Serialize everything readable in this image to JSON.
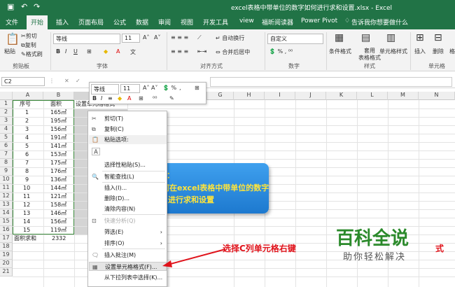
{
  "window": {
    "title": "excel表格中带单位的数字如何进行求和设置.xlsx - Excel"
  },
  "tabs": [
    {
      "label": "文件"
    },
    {
      "label": "开始"
    },
    {
      "label": "插入"
    },
    {
      "label": "页面布局"
    },
    {
      "label": "公式"
    },
    {
      "label": "数据"
    },
    {
      "label": "审阅"
    },
    {
      "label": "视图"
    },
    {
      "label": "开发工具"
    },
    {
      "label": "view"
    },
    {
      "label": "福昕阅读器"
    },
    {
      "label": "Power Pivot"
    },
    {
      "label": "告诉我你想要做什么"
    }
  ],
  "ribbon": {
    "clipboard": {
      "paste": "粘贴",
      "cut": "剪切",
      "copy": "复制",
      "format_painter": "格式刷",
      "label": "剪贴板"
    },
    "font": {
      "name": "等线",
      "size": "11",
      "label": "字体"
    },
    "alignment": {
      "wrap": "自动换行",
      "merge": "合并后居中",
      "label": "对齐方式"
    },
    "number": {
      "format": "自定义",
      "label": "数字"
    },
    "styles": {
      "conditional": "条件格式",
      "table": "套用\n表格格式",
      "cell": "单元格样式",
      "label": "样式"
    },
    "cells": {
      "insert": "插入",
      "delete": "删除",
      "format": "格式",
      "label": "单元格"
    }
  },
  "formula_bar": {
    "name_box": "C2"
  },
  "columns": [
    "A",
    "B",
    "C",
    "D",
    "E",
    "F",
    "G",
    "H",
    "I",
    "J",
    "K",
    "L",
    "M",
    "N"
  ],
  "rows": [
    "1",
    "2",
    "3",
    "4",
    "5",
    "6",
    "7",
    "8",
    "9",
    "10",
    "11",
    "12",
    "13",
    "14",
    "15",
    "16",
    "17",
    "18",
    "19",
    "20",
    "21"
  ],
  "table": {
    "headers": [
      "序号",
      "面积",
      "设置单元格格式"
    ],
    "data": [
      [
        "1",
        "165㎡"
      ],
      [
        "2",
        "195㎡"
      ],
      [
        "3",
        "156㎡"
      ],
      [
        "4",
        "191㎡"
      ],
      [
        "5",
        "141㎡"
      ],
      [
        "6",
        "153㎡"
      ],
      [
        "7",
        "175㎡"
      ],
      [
        "8",
        "176㎡"
      ],
      [
        "9",
        "136㎡"
      ],
      [
        "10",
        "144㎡"
      ],
      [
        "11",
        "121㎡"
      ],
      [
        "12",
        "158㎡"
      ],
      [
        "13",
        "146㎡"
      ],
      [
        "14",
        "156㎡"
      ],
      [
        "15",
        "119㎡"
      ]
    ],
    "sum_label": "面积求和",
    "sum_value": "2332"
  },
  "mini_toolbar": {
    "font": "等线",
    "size": "11"
  },
  "context_menu": [
    {
      "label": "剪切(T)",
      "icon": "scissors-icon",
      "state": "normal"
    },
    {
      "label": "复制(C)",
      "icon": "copy-icon",
      "state": "normal"
    },
    {
      "label": "粘贴选项:",
      "icon": "paste-icon",
      "state": "header"
    },
    {
      "label": "",
      "icon": "paste-a-icon",
      "state": "normal"
    },
    {
      "label": "选择性粘贴(S)...",
      "icon": "",
      "state": "normal"
    },
    {
      "label": "智能查找(L)",
      "icon": "search-icon",
      "state": "normal"
    },
    {
      "label": "插入(I)...",
      "icon": "",
      "state": "normal"
    },
    {
      "label": "删除(D)...",
      "icon": "",
      "state": "normal"
    },
    {
      "label": "清除内容(N)",
      "icon": "",
      "state": "normal"
    },
    {
      "label": "快速分析(Q)",
      "icon": "quick-analysis-icon",
      "state": "disabled"
    },
    {
      "label": "筛选(E)",
      "icon": "",
      "state": "submenu"
    },
    {
      "label": "排序(O)",
      "icon": "",
      "state": "submenu"
    },
    {
      "label": "插入批注(M)",
      "icon": "comment-icon",
      "state": "normal"
    },
    {
      "label": "设置单元格格式(F)...",
      "icon": "format-cells-icon",
      "state": "highlight"
    },
    {
      "label": "从下拉列表中选择(K)...",
      "icon": "",
      "state": "normal"
    }
  ],
  "overlay": {
    "blue_lines": [
      "：",
      "如何在excel表格中带单位的数字",
      "进行求和设置"
    ],
    "annotation": "选择C列单元格右键",
    "annotation_tail": "式",
    "watermark_main": "百科全说",
    "watermark_sub": "助你轻松解决"
  },
  "colors": {
    "excel_green": "#217346",
    "annotation_red": "#e0131b",
    "highlight_gray": "#e5e5e5"
  }
}
